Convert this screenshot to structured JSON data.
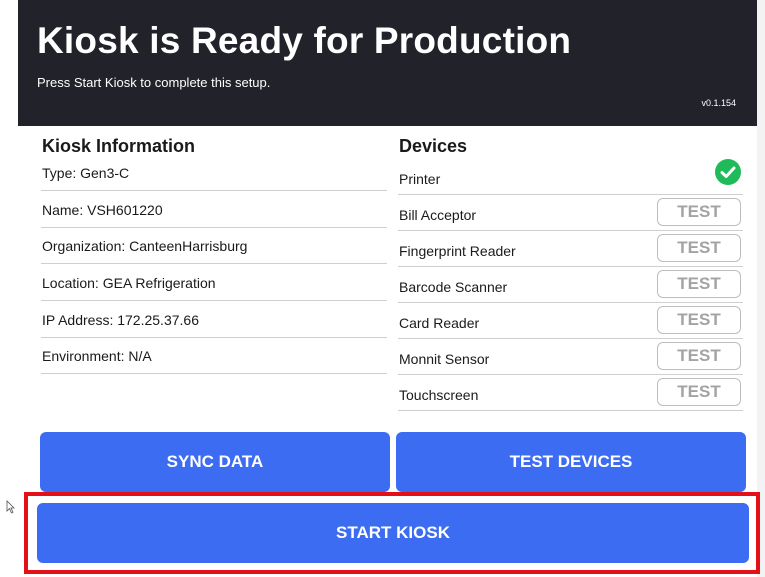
{
  "header": {
    "title": "Kiosk is Ready for Production",
    "subtitle": "Press Start Kiosk to complete this setup.",
    "version": "v0.1.154"
  },
  "kiosk_info": {
    "title": "Kiosk Information",
    "rows": [
      "Type: Gen3-C",
      "Name: VSH601220",
      "Organization: CanteenHarrisburg",
      "Location: GEA Refrigeration",
      "IP Address: 172.25.37.66",
      "Environment: N/A"
    ]
  },
  "devices": {
    "title": "Devices",
    "test_label": "TEST",
    "items": [
      {
        "label": "Printer",
        "status": "ok",
        "icon": "check-circle-icon"
      },
      {
        "label": "Bill Acceptor",
        "status": "untested"
      },
      {
        "label": "Fingerprint Reader",
        "status": "untested"
      },
      {
        "label": "Barcode Scanner",
        "status": "untested"
      },
      {
        "label": "Card Reader",
        "status": "untested"
      },
      {
        "label": "Monnit Sensor",
        "status": "untested"
      },
      {
        "label": "Touchscreen",
        "status": "untested"
      }
    ]
  },
  "actions": {
    "sync_label": "SYNC DATA",
    "test_devices_label": "TEST DEVICES",
    "start_label": "START KIOSK"
  },
  "colors": {
    "header_bg": "#22222a",
    "button_blue": "#3b6cf2",
    "check_green": "#1fba5a",
    "highlight_red": "#e3101a"
  }
}
